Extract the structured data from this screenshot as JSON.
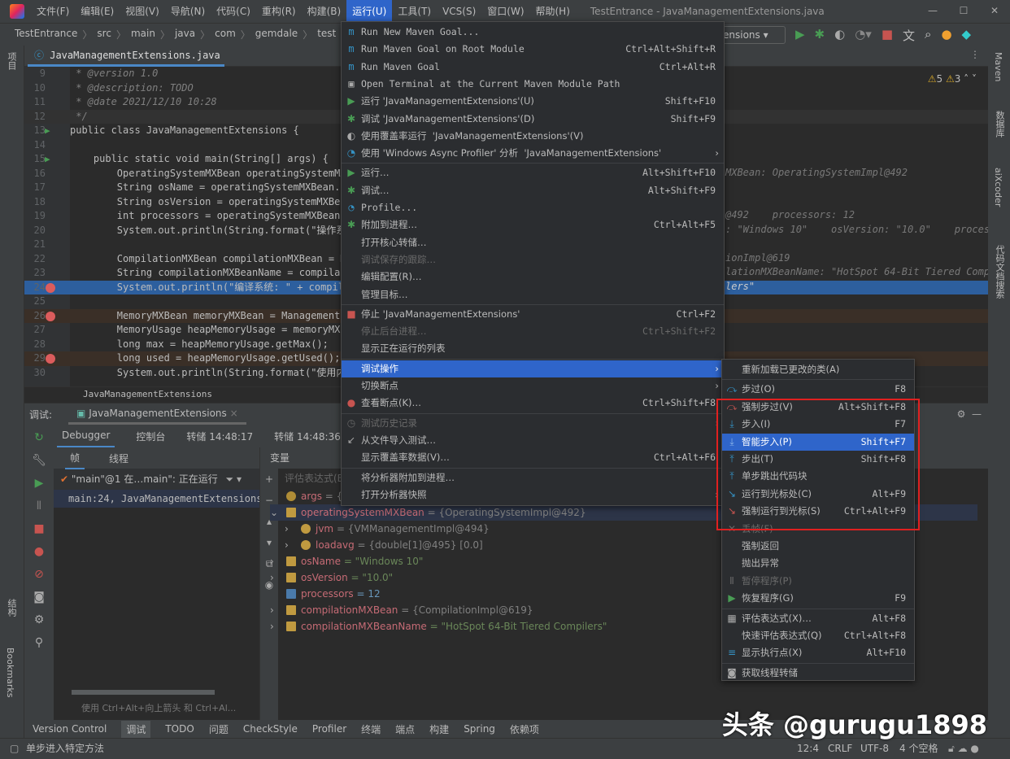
{
  "titlebar": {
    "menus": [
      "文件(F)",
      "编辑(E)",
      "视图(V)",
      "导航(N)",
      "代码(C)",
      "重构(R)",
      "构建(B)",
      "运行(U)",
      "工具(T)",
      "VCS(S)",
      "窗口(W)",
      "帮助(H)"
    ],
    "active_menu": "运行(U)",
    "title": "TestEntrance - JavaManagementExtensions.java"
  },
  "navbar": {
    "breadcrumb": [
      "TestEntrance",
      "src",
      "main",
      "java",
      "com",
      "gemdale",
      "test",
      "JavaMana"
    ],
    "run_config": "ensions"
  },
  "left_strip": {
    "top": "项目",
    "mid": "结构",
    "bottom": "Bookmarks"
  },
  "right_strip": [
    "Maven",
    "数据库",
    "aiXcoder",
    "代码文档搜索"
  ],
  "editor": {
    "tab": "JavaManagementExtensions.java",
    "warnings": "5",
    "weak_warnings": "3",
    "lines": [
      {
        "n": "9",
        "html": " * @version 1.0"
      },
      {
        "n": "10",
        "html": " * @description: TODO"
      },
      {
        "n": "11",
        "html": " * @date 2021/12/10 10:28"
      },
      {
        "n": "12",
        "html": " */"
      },
      {
        "n": "13",
        "html": "public class JavaManagementExtensions {"
      },
      {
        "n": "14",
        "html": ""
      },
      {
        "n": "15",
        "html": "    public static void main(String[] args) {   ar"
      },
      {
        "n": "16",
        "html": "        OperatingSystemMXBean operatingSystemMXBe"
      },
      {
        "n": "17",
        "html": "        String osName = operatingSystemMXBean.get"
      },
      {
        "n": "18",
        "html": "        String osVersion = operatingSystemMXBean."
      },
      {
        "n": "19",
        "html": "        int processors = operatingSystemMXBean.ge"
      },
      {
        "n": "20",
        "html": "        System.out.println(String.format(\"操作系统"
      },
      {
        "n": "21",
        "html": ""
      },
      {
        "n": "22",
        "html": "        CompilationMXBean compilationMXBean = Man"
      },
      {
        "n": "23",
        "html": "        String compilationMXBeanName = compilatio"
      },
      {
        "n": "24",
        "html": "        System.out.println(\"编译系统: \" + compilat"
      },
      {
        "n": "25",
        "html": ""
      },
      {
        "n": "26",
        "html": "        MemoryMXBean memoryMXBean = ManagementFac"
      },
      {
        "n": "27",
        "html": "        MemoryUsage heapMemoryUsage = memoryMXBea"
      },
      {
        "n": "28",
        "html": "        long max = heapMemoryUsage.getMax();"
      },
      {
        "n": "29",
        "html": "        long used = heapMemoryUsage.getUsed();"
      },
      {
        "n": "30",
        "html": "        System.out.println(String.format(\"使用内存"
      }
    ],
    "hints": {
      "l16": "MXBean: OperatingSystemImpl@492",
      "l19": "@492    processors: 12",
      "l20": ": \"Windows 10\"    osVersion: \"10.0\"    process",
      "l22": "ionImpl@619",
      "l23": "lationMXBeanName: \"HotSpot 64-Bit Tiered Compil",
      "l24": "lers\""
    },
    "bottom_crumb": "JavaManagementExtensions"
  },
  "debug": {
    "label": "调试:",
    "session": "JavaManagementExtensions",
    "tabs": [
      "Debugger",
      "控制台",
      "转储 14:48:17",
      "转储 14:48:36"
    ],
    "frames_tabs": [
      "帧",
      "线程"
    ],
    "thread": "\"main\"@1 在…main\": 正在运行",
    "frame": "main:24, JavaManagementExtensions (c",
    "frames_hint": "使用 Ctrl+Alt+向上箭头 和 Ctrl+Al...",
    "vars_title": "变量",
    "eval_placeholder": "评估表达式(E",
    "vars": [
      {
        "name": "args",
        "val": " = {String[0]@",
        "type": "p",
        "indent": 0,
        "exp": ""
      },
      {
        "name": "operatingSystemMXBean",
        "val": " = {OperatingSystemImpl@492}",
        "type": "f",
        "indent": 0,
        "exp": "v"
      },
      {
        "name": "jvm",
        "val": " = {VMManagementImpl@494}",
        "type": "fo",
        "indent": 1,
        "exp": ">"
      },
      {
        "name": "loadavg",
        "val": " = {double[1]@495} [0.0]",
        "type": "fo",
        "indent": 1,
        "exp": ">"
      },
      {
        "name": "osName",
        "val": " = \"Windows 10\"",
        "type": "f",
        "indent": 0,
        "exp": ">"
      },
      {
        "name": "osVersion",
        "val": " = \"10.0\"",
        "type": "f",
        "indent": 0,
        "exp": ">"
      },
      {
        "name": "processors",
        "val": " = 12",
        "type": "n",
        "indent": 0,
        "exp": ""
      },
      {
        "name": "compilationMXBean",
        "val": " = {CompilationImpl@619}",
        "type": "f",
        "indent": 0,
        "exp": ">"
      },
      {
        "name": "compilationMXBeanName",
        "val": " = \"HotSpot 64-Bit Tiered Compilers\"",
        "type": "f",
        "indent": 0,
        "exp": ">"
      }
    ]
  },
  "run_menu": [
    {
      "label": "Run New Maven Goal...",
      "icon": "maven",
      "mono": true
    },
    {
      "label": "Run Maven Goal on Root Module",
      "sc": "Ctrl+Alt+Shift+R",
      "icon": "maven",
      "mono": true
    },
    {
      "label": "Run Maven Goal",
      "sc": "Ctrl+Alt+R",
      "icon": "maven",
      "mono": true
    },
    {
      "label": "Open Terminal at the Current Maven Module Path",
      "icon": "terminal",
      "mono": true
    },
    {
      "label": "运行 'JavaManagementExtensions'(U)",
      "sc": "Shift+F10",
      "icon": "run"
    },
    {
      "label": "调试 'JavaManagementExtensions'(D)",
      "sc": "Shift+F9",
      "icon": "debug"
    },
    {
      "label": "使用覆盖率运行  'JavaManagementExtensions'(V)",
      "icon": "coverage"
    },
    {
      "label": "使用 'Windows Async Profiler' 分析  'JavaManagementExtensions'",
      "icon": "profiler",
      "sub": true,
      "sep": true
    },
    {
      "label": "运行…",
      "sc": "Alt+Shift+F10",
      "icon": "run"
    },
    {
      "label": "调试…",
      "sc": "Alt+Shift+F9",
      "icon": "debug"
    },
    {
      "label": "Profile...",
      "icon": "profiler",
      "mono": true
    },
    {
      "label": "附加到进程…",
      "sc": "Ctrl+Alt+F5",
      "icon": "attach"
    },
    {
      "label": "打开核心转储…"
    },
    {
      "label": "调试保存的跟踪…",
      "dis": true
    },
    {
      "label": "编辑配置(R)…"
    },
    {
      "label": "管理目标…",
      "sep": true
    },
    {
      "label": "停止 'JavaManagementExtensions'",
      "sc": "Ctrl+F2",
      "icon": "stop"
    },
    {
      "label": "停止后台进程…",
      "sc": "Ctrl+Shift+F2",
      "dis": true
    },
    {
      "label": "显示正在运行的列表",
      "sep": true
    },
    {
      "label": "调试操作",
      "sub": true,
      "hl": true
    },
    {
      "label": "切换断点",
      "sub": true
    },
    {
      "label": "查看断点(K)…",
      "sc": "Ctrl+Shift+F8",
      "icon": "breakpoints",
      "sep": true
    },
    {
      "label": "测试历史记录",
      "icon": "history",
      "dis": true,
      "sub": true
    },
    {
      "label": "从文件导入测试…",
      "icon": "import"
    },
    {
      "label": "显示覆盖率数据(V)…",
      "sc": "Ctrl+Alt+F6",
      "sep": true
    },
    {
      "label": "将分析器附加到进程…"
    },
    {
      "label": "打开分析器快照",
      "sub": true
    }
  ],
  "debug_submenu": [
    {
      "label": "重新加载已更改的类(A)",
      "sep": true
    },
    {
      "label": "步过(O)",
      "sc": "F8",
      "icon": "step-over"
    },
    {
      "label": "强制步过(V)",
      "sc": "Alt+Shift+F8",
      "icon": "force-step-over"
    },
    {
      "label": "步入(I)",
      "sc": "F7",
      "icon": "step-into"
    },
    {
      "label": "智能步入(P)",
      "sc": "Shift+F7",
      "icon": "smart-step-into",
      "hl": true
    },
    {
      "label": "步出(T)",
      "sc": "Shift+F8",
      "icon": "step-out"
    },
    {
      "label": "单步跳出代码块",
      "icon": "step-out-block"
    },
    {
      "label": "运行到光标处(C)",
      "sc": "Alt+F9",
      "icon": "run-to-cursor"
    },
    {
      "label": "强制运行到光标(S)",
      "sc": "Ctrl+Alt+F9",
      "icon": "force-run-to-cursor"
    },
    {
      "label": "丢帧(F)",
      "icon": "drop-frame",
      "dis": true
    },
    {
      "label": "强制返回"
    },
    {
      "label": "抛出异常"
    },
    {
      "label": "暂停程序(P)",
      "icon": "pause",
      "dis": true
    },
    {
      "label": "恢复程序(G)",
      "sc": "F9",
      "icon": "resume",
      "sep": true
    },
    {
      "label": "评估表达式(X)…",
      "sc": "Alt+F8",
      "icon": "calculator"
    },
    {
      "label": "快速评估表达式(Q)",
      "sc": "Ctrl+Alt+F8"
    },
    {
      "label": "显示执行点(X)",
      "sc": "Alt+F10",
      "icon": "execution-point",
      "sep": true
    },
    {
      "label": "获取线程转储",
      "icon": "camera"
    }
  ],
  "toolwindows": [
    "Version Control",
    "调试",
    "TODO",
    "问题",
    "CheckStyle",
    "Profiler",
    "终端",
    "端点",
    "构建",
    "Spring",
    "依赖项"
  ],
  "status": {
    "message": "单步进入特定方法",
    "position": "12:4",
    "line_sep": "CRLF",
    "encoding": "UTF-8",
    "indent": "4 个空格"
  },
  "watermark": "头条 @gurugu1898",
  "colors": {
    "accent": "#2f65ca",
    "highlight_box": "#e02020",
    "selection": "#2d5f9e"
  }
}
